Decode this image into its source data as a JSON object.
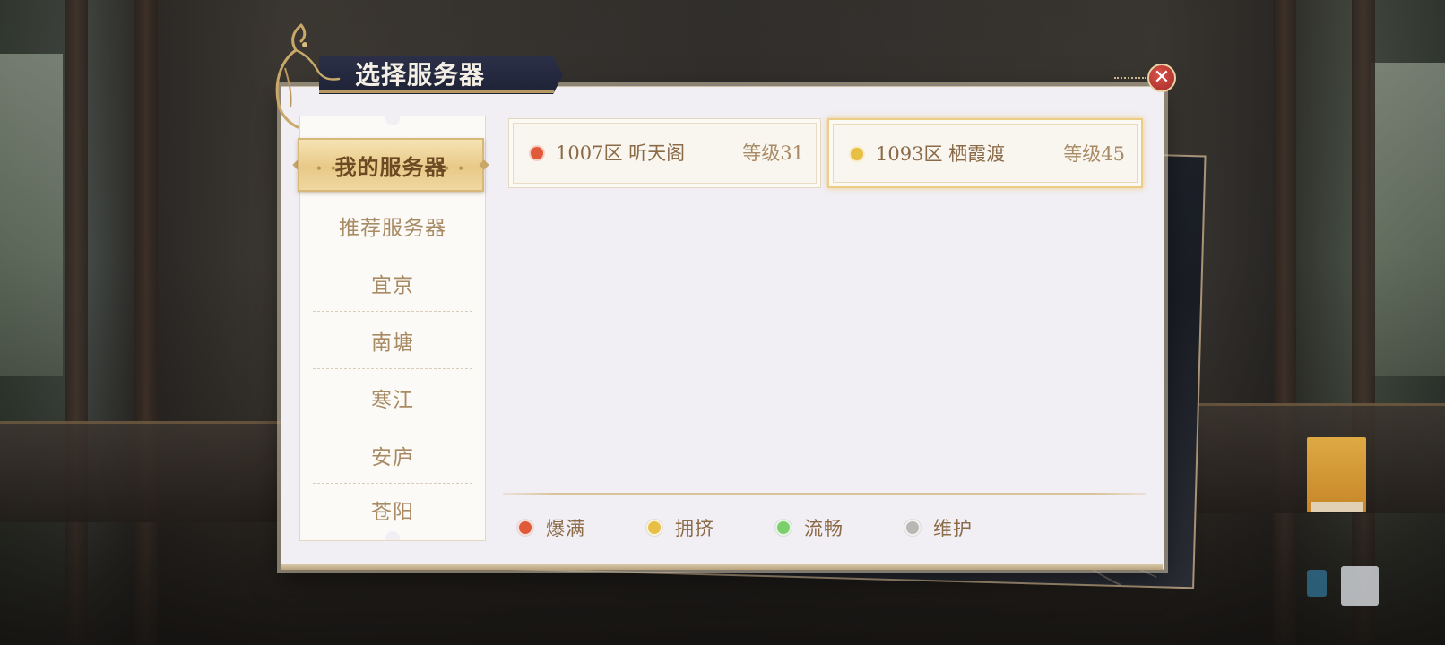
{
  "window": {
    "title": "选择服务器"
  },
  "sidebar": {
    "items": [
      {
        "label": "我的服务器",
        "selected": true
      },
      {
        "label": "推荐服务器",
        "selected": false
      },
      {
        "label": "宜京",
        "selected": false
      },
      {
        "label": "南塘",
        "selected": false
      },
      {
        "label": "寒江",
        "selected": false
      },
      {
        "label": "安庐",
        "selected": false
      },
      {
        "label": "苍阳",
        "selected": false
      }
    ]
  },
  "servers": [
    {
      "name": "1007区 听天阁",
      "level": "等级31",
      "status": "爆满",
      "status_color": "#e05a3a",
      "selected": false
    },
    {
      "name": "1093区 栖霞渡",
      "level": "等级45",
      "status": "拥挤",
      "status_color": "#e8bf45",
      "selected": true
    }
  ],
  "legend": [
    {
      "label": "爆满",
      "color": "#e05a3a"
    },
    {
      "label": "拥挤",
      "color": "#e8bf45"
    },
    {
      "label": "流畅",
      "color": "#7ccf6b"
    },
    {
      "label": "维护",
      "color": "#b9b7b4"
    }
  ],
  "icons": {
    "close": "close-icon",
    "emblem": "deer-emblem-icon"
  },
  "colors": {
    "accent_gold": "#e8c988",
    "text_brown": "#8a6a47",
    "close_red": "#b8322c"
  }
}
